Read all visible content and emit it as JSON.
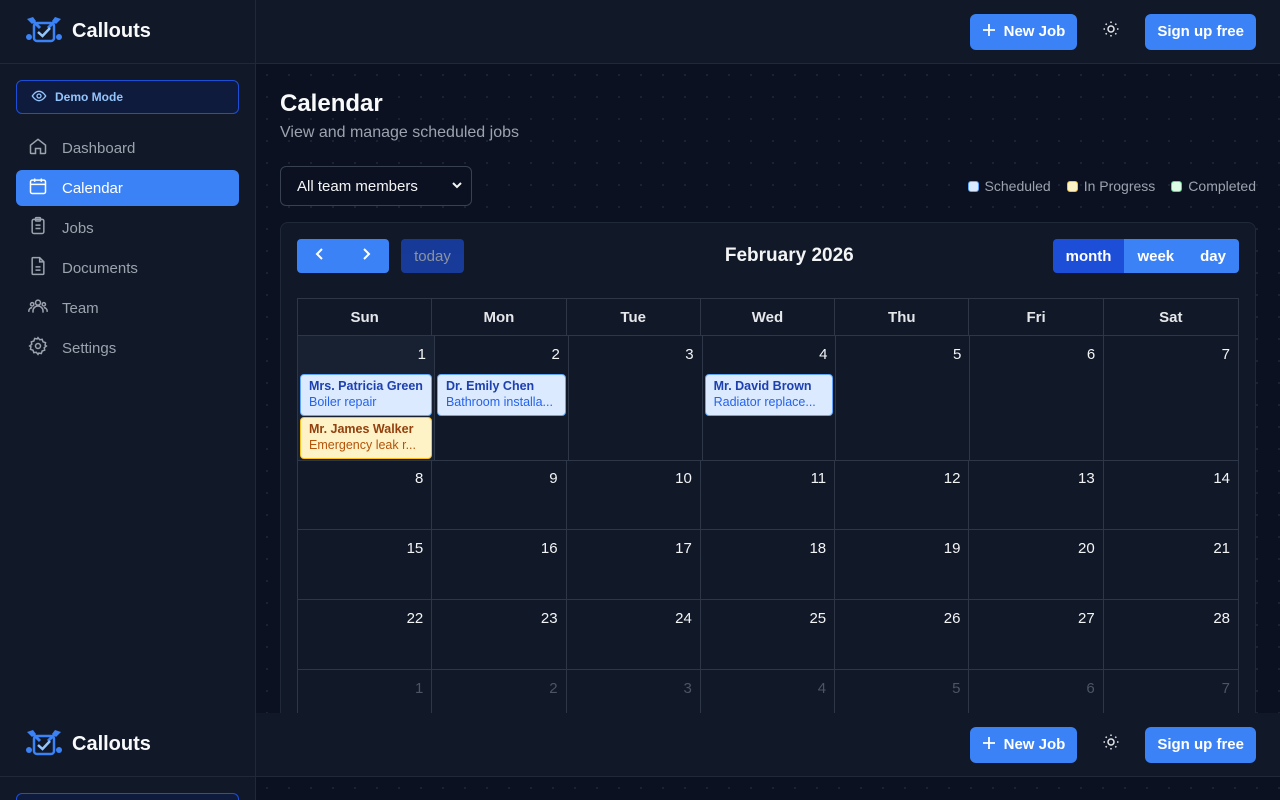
{
  "app": {
    "name": "Callouts"
  },
  "header": {
    "new_job_label": "New Job",
    "signup_label": "Sign up free"
  },
  "sidebar": {
    "demo_label": "Demo Mode",
    "items": [
      {
        "label": "Dashboard",
        "icon": "home-icon"
      },
      {
        "label": "Calendar",
        "icon": "calendar-icon",
        "active": true
      },
      {
        "label": "Jobs",
        "icon": "clipboard-icon"
      },
      {
        "label": "Documents",
        "icon": "document-icon"
      },
      {
        "label": "Team",
        "icon": "team-icon"
      },
      {
        "label": "Settings",
        "icon": "gear-icon"
      }
    ]
  },
  "page": {
    "title": "Calendar",
    "subtitle": "View and manage scheduled jobs"
  },
  "filter": {
    "selected": "All team members"
  },
  "legend": [
    {
      "label": "Scheduled",
      "fill": "#dbeafe",
      "border": "#60a5fa"
    },
    {
      "label": "In Progress",
      "fill": "#fef3c7",
      "border": "#fbbf24"
    },
    {
      "label": "Completed",
      "fill": "#dcfce7",
      "border": "#4ade80"
    }
  ],
  "calendar": {
    "today_label": "today",
    "month_title": "February 2026",
    "views": [
      "month",
      "week",
      "day"
    ],
    "active_view": "month",
    "weekdays": [
      "Sun",
      "Mon",
      "Tue",
      "Wed",
      "Thu",
      "Fri",
      "Sat"
    ],
    "weeks": [
      [
        "1",
        "2",
        "3",
        "4",
        "5",
        "6",
        "7"
      ],
      [
        "8",
        "9",
        "10",
        "11",
        "12",
        "13",
        "14"
      ],
      [
        "15",
        "16",
        "17",
        "18",
        "19",
        "20",
        "21"
      ],
      [
        "22",
        "23",
        "24",
        "25",
        "26",
        "27",
        "28"
      ],
      [
        "1",
        "2",
        "3",
        "4",
        "5",
        "6",
        "7"
      ]
    ],
    "events": [
      {
        "week": 0,
        "day": 0,
        "title": "Mrs. Patricia Green",
        "subtitle": "Boiler repair",
        "status": "scheduled"
      },
      {
        "week": 0,
        "day": 0,
        "title": "Mr. James Walker",
        "subtitle": "Emergency leak r...",
        "status": "inprogress"
      },
      {
        "week": 0,
        "day": 1,
        "title": "Dr. Emily Chen",
        "subtitle": "Bathroom installa...",
        "status": "scheduled"
      },
      {
        "week": 0,
        "day": 3,
        "title": "Mr. David Brown",
        "subtitle": "Radiator replace...",
        "status": "scheduled"
      }
    ]
  }
}
